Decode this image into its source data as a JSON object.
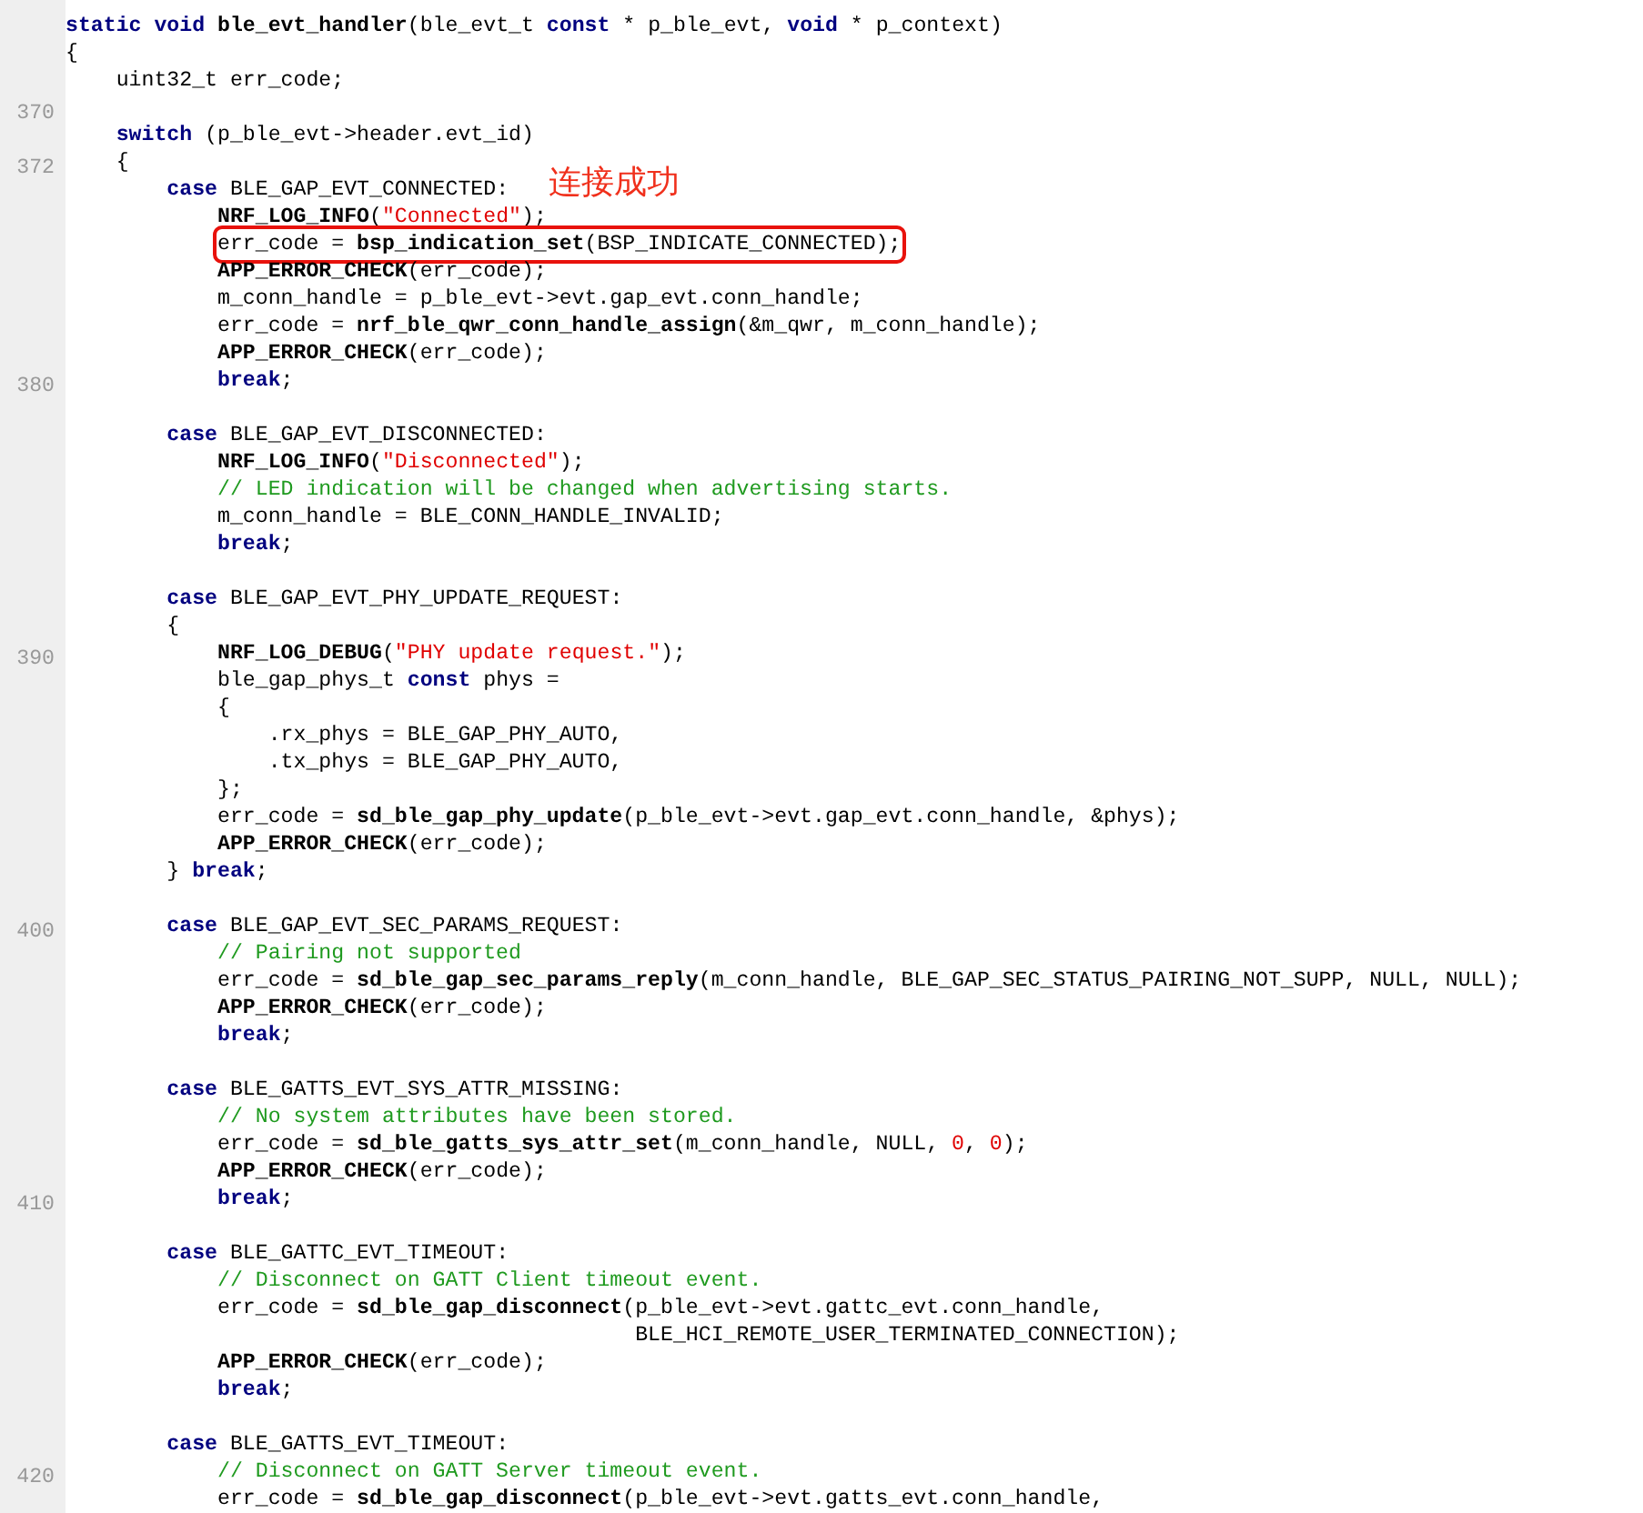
{
  "lines": [
    {
      "tokens": [
        {
          "kind": "keyword",
          "text": "static void "
        },
        {
          "kind": "function",
          "text": "ble_evt_handler"
        },
        {
          "kind": "plain",
          "text": "(ble_evt_t "
        },
        {
          "kind": "keyword",
          "text": "const"
        },
        {
          "kind": "plain",
          "text": " * p_ble_evt, "
        },
        {
          "kind": "keyword",
          "text": "void"
        },
        {
          "kind": "plain",
          "text": " * p_context)"
        }
      ]
    },
    {
      "tokens": [
        {
          "kind": "plain",
          "text": "{"
        }
      ]
    },
    {
      "tokens": [
        {
          "kind": "plain",
          "text": "    uint32_t err_code;"
        }
      ]
    },
    {
      "number": "370"
    },
    {
      "tokens": [
        {
          "kind": "keyword",
          "text": "    switch"
        },
        {
          "kind": "plain",
          "text": " (p_ble_evt->header.evt_id)"
        }
      ]
    },
    {
      "number": "372",
      "tokens": [
        {
          "kind": "plain",
          "text": "    {"
        }
      ]
    },
    {
      "tokens": [
        {
          "kind": "keyword",
          "text": "        case"
        },
        {
          "kind": "plain",
          "text": " BLE_GAP_EVT_CONNECTED:"
        }
      ],
      "note": "连接成功"
    },
    {
      "tokens": [
        {
          "kind": "function",
          "text": "            NRF_LOG_INFO"
        },
        {
          "kind": "plain",
          "text": "("
        },
        {
          "kind": "string",
          "text": "\"Connected\""
        },
        {
          "kind": "plain",
          "text": ");"
        }
      ]
    },
    {
      "highlighted": true,
      "tokens": [
        {
          "kind": "plain",
          "text": "            err_code = "
        },
        {
          "kind": "function",
          "text": "bsp_indication_set"
        },
        {
          "kind": "plain",
          "text": "(BSP_INDICATE_CONNECTED);"
        }
      ]
    },
    {
      "tokens": [
        {
          "kind": "function",
          "text": "            APP_ERROR_CHECK"
        },
        {
          "kind": "plain",
          "text": "(err_code);"
        }
      ]
    },
    {
      "tokens": [
        {
          "kind": "plain",
          "text": "            m_conn_handle = p_ble_evt->evt.gap_evt.conn_handle;"
        }
      ]
    },
    {
      "tokens": [
        {
          "kind": "plain",
          "text": "            err_code = "
        },
        {
          "kind": "function",
          "text": "nrf_ble_qwr_conn_handle_assign"
        },
        {
          "kind": "plain",
          "text": "(&m_qwr, m_conn_handle);"
        }
      ]
    },
    {
      "tokens": [
        {
          "kind": "function",
          "text": "            APP_ERROR_CHECK"
        },
        {
          "kind": "plain",
          "text": "(err_code);"
        }
      ]
    },
    {
      "number": "380",
      "tokens": [
        {
          "kind": "keyword",
          "text": "            break"
        },
        {
          "kind": "plain",
          "text": ";"
        }
      ]
    },
    {
      "gap_before": true,
      "tokens": [
        {
          "kind": "keyword",
          "text": "        case"
        },
        {
          "kind": "plain",
          "text": " BLE_GAP_EVT_DISCONNECTED:"
        }
      ]
    },
    {
      "tokens": [
        {
          "kind": "function",
          "text": "            NRF_LOG_INFO"
        },
        {
          "kind": "plain",
          "text": "("
        },
        {
          "kind": "string",
          "text": "\"Disconnected\""
        },
        {
          "kind": "plain",
          "text": ");"
        }
      ]
    },
    {
      "tokens": [
        {
          "kind": "comment",
          "text": "            // LED indication will be changed when advertising starts."
        }
      ]
    },
    {
      "tokens": [
        {
          "kind": "plain",
          "text": "            m_conn_handle = BLE_CONN_HANDLE_INVALID;"
        }
      ]
    },
    {
      "tokens": [
        {
          "kind": "keyword",
          "text": "            break"
        },
        {
          "kind": "plain",
          "text": ";"
        }
      ]
    },
    {
      "gap_before": true,
      "tokens": [
        {
          "kind": "keyword",
          "text": "        case"
        },
        {
          "kind": "plain",
          "text": " BLE_GAP_EVT_PHY_UPDATE_REQUEST:"
        }
      ]
    },
    {
      "tokens": [
        {
          "kind": "plain",
          "text": "        {"
        }
      ]
    },
    {
      "number": "390",
      "tokens": [
        {
          "kind": "function",
          "text": "            NRF_LOG_DEBUG"
        },
        {
          "kind": "plain",
          "text": "("
        },
        {
          "kind": "string",
          "text": "\"PHY update request.\""
        },
        {
          "kind": "plain",
          "text": ");"
        }
      ]
    },
    {
      "tokens": [
        {
          "kind": "plain",
          "text": "            ble_gap_phys_t "
        },
        {
          "kind": "keyword",
          "text": "const"
        },
        {
          "kind": "plain",
          "text": " phys ="
        }
      ]
    },
    {
      "tokens": [
        {
          "kind": "plain",
          "text": "            {"
        }
      ]
    },
    {
      "tokens": [
        {
          "kind": "plain",
          "text": "                .rx_phys = BLE_GAP_PHY_AUTO,"
        }
      ]
    },
    {
      "tokens": [
        {
          "kind": "plain",
          "text": "                .tx_phys = BLE_GAP_PHY_AUTO,"
        }
      ]
    },
    {
      "tokens": [
        {
          "kind": "plain",
          "text": "            };"
        }
      ]
    },
    {
      "tokens": [
        {
          "kind": "plain",
          "text": "            err_code = "
        },
        {
          "kind": "function",
          "text": "sd_ble_gap_phy_update"
        },
        {
          "kind": "plain",
          "text": "(p_ble_evt->evt.gap_evt.conn_handle, &phys);"
        }
      ]
    },
    {
      "tokens": [
        {
          "kind": "function",
          "text": "            APP_ERROR_CHECK"
        },
        {
          "kind": "plain",
          "text": "(err_code);"
        }
      ]
    },
    {
      "tokens": [
        {
          "kind": "plain",
          "text": "        } "
        },
        {
          "kind": "keyword",
          "text": "break"
        },
        {
          "kind": "plain",
          "text": ";"
        }
      ]
    },
    {
      "gap_before": true,
      "number": "400",
      "tokens": [
        {
          "kind": "keyword",
          "text": "        case"
        },
        {
          "kind": "plain",
          "text": " BLE_GAP_EVT_SEC_PARAMS_REQUEST:"
        }
      ]
    },
    {
      "tokens": [
        {
          "kind": "comment",
          "text": "            // Pairing not supported"
        }
      ]
    },
    {
      "tokens": [
        {
          "kind": "plain",
          "text": "            err_code = "
        },
        {
          "kind": "function",
          "text": "sd_ble_gap_sec_params_reply"
        },
        {
          "kind": "plain",
          "text": "(m_conn_handle, BLE_GAP_SEC_STATUS_PAIRING_NOT_SUPP, NULL, NULL);"
        }
      ]
    },
    {
      "tokens": [
        {
          "kind": "function",
          "text": "            APP_ERROR_CHECK"
        },
        {
          "kind": "plain",
          "text": "(err_code);"
        }
      ]
    },
    {
      "tokens": [
        {
          "kind": "keyword",
          "text": "            break"
        },
        {
          "kind": "plain",
          "text": ";"
        }
      ]
    },
    {
      "gap_before": true,
      "tokens": [
        {
          "kind": "keyword",
          "text": "        case"
        },
        {
          "kind": "plain",
          "text": " BLE_GATTS_EVT_SYS_ATTR_MISSING:"
        }
      ]
    },
    {
      "tokens": [
        {
          "kind": "comment",
          "text": "            // No system attributes have been stored."
        }
      ]
    },
    {
      "tokens": [
        {
          "kind": "plain",
          "text": "            err_code = "
        },
        {
          "kind": "function",
          "text": "sd_ble_gatts_sys_attr_set"
        },
        {
          "kind": "plain",
          "text": "(m_conn_handle, NULL, "
        },
        {
          "kind": "number",
          "text": "0"
        },
        {
          "kind": "plain",
          "text": ", "
        },
        {
          "kind": "number",
          "text": "0"
        },
        {
          "kind": "plain",
          "text": ");"
        }
      ]
    },
    {
      "tokens": [
        {
          "kind": "function",
          "text": "            APP_ERROR_CHECK"
        },
        {
          "kind": "plain",
          "text": "(err_code);"
        }
      ]
    },
    {
      "number": "410",
      "tokens": [
        {
          "kind": "keyword",
          "text": "            break"
        },
        {
          "kind": "plain",
          "text": ";"
        }
      ]
    },
    {
      "gap_before": true,
      "tokens": [
        {
          "kind": "keyword",
          "text": "        case"
        },
        {
          "kind": "plain",
          "text": " BLE_GATTC_EVT_TIMEOUT:"
        }
      ]
    },
    {
      "tokens": [
        {
          "kind": "comment",
          "text": "            // Disconnect on GATT Client timeout event."
        }
      ]
    },
    {
      "tokens": [
        {
          "kind": "plain",
          "text": "            err_code = "
        },
        {
          "kind": "function",
          "text": "sd_ble_gap_disconnect"
        },
        {
          "kind": "plain",
          "text": "(p_ble_evt->evt.gattc_evt.conn_handle,"
        }
      ]
    },
    {
      "tokens": [
        {
          "kind": "plain",
          "text": "                                             BLE_HCI_REMOTE_USER_TERMINATED_CONNECTION);"
        }
      ]
    },
    {
      "tokens": [
        {
          "kind": "function",
          "text": "            APP_ERROR_CHECK"
        },
        {
          "kind": "plain",
          "text": "(err_code);"
        }
      ]
    },
    {
      "tokens": [
        {
          "kind": "keyword",
          "text": "            break"
        },
        {
          "kind": "plain",
          "text": ";"
        }
      ]
    },
    {
      "gap_before": true,
      "tokens": [
        {
          "kind": "keyword",
          "text": "        case"
        },
        {
          "kind": "plain",
          "text": " BLE_GATTS_EVT_TIMEOUT:"
        }
      ]
    },
    {
      "number": "420",
      "tokens": [
        {
          "kind": "comment",
          "text": "            // Disconnect on GATT Server timeout event."
        }
      ]
    },
    {
      "tokens": [
        {
          "kind": "plain",
          "text": "            err_code = "
        },
        {
          "kind": "function",
          "text": "sd_ble_gap_disconnect"
        },
        {
          "kind": "plain",
          "text": "(p_ble_evt->evt.gatts_evt.conn_handle,"
        }
      ]
    }
  ]
}
